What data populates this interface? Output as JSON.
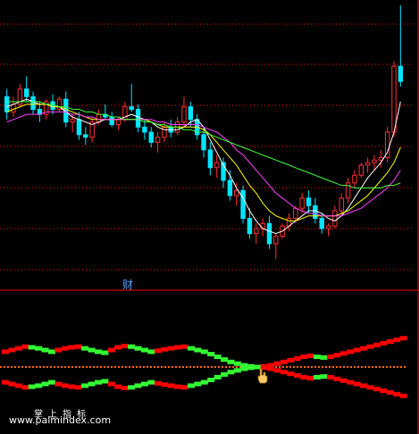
{
  "labels": {
    "cai": "财",
    "watermark_top": "掌上指标",
    "watermark_bottom": "www.palmindex.com"
  },
  "colors": {
    "background": "#000000",
    "up": "#ff3030",
    "down": "#00e5ff",
    "ma_white": "#ffffff",
    "ma_yellow": "#ffff00",
    "ma_magenta": "#ff40ff",
    "ma_green": "#40ff40",
    "grid": "#ff0000",
    "osc_red": "#ff0000",
    "osc_green": "#33ff33",
    "osc_mid": "#ff6600",
    "label_blue": "#5aa0ff"
  },
  "icons": [
    "hand-cursor-icon"
  ],
  "chart_data": [
    {
      "type": "candlestick",
      "title": "",
      "ylim": [
        0,
        100
      ],
      "grid": true,
      "candles": [
        [
          64,
          67,
          55,
          58
        ],
        [
          58,
          64,
          56,
          61
        ],
        [
          61,
          69,
          60,
          67
        ],
        [
          67,
          72,
          62,
          64
        ],
        [
          64,
          66,
          57,
          59
        ],
        [
          59,
          62,
          54,
          57
        ],
        [
          57,
          63,
          55,
          62
        ],
        [
          62,
          65,
          57,
          59
        ],
        [
          59,
          64,
          58,
          63
        ],
        [
          63,
          66,
          52,
          54
        ],
        [
          54,
          57,
          50,
          55
        ],
        [
          55,
          58,
          47,
          49
        ],
        [
          49,
          52,
          45,
          48
        ],
        [
          48,
          56,
          46,
          54
        ],
        [
          54,
          59,
          53,
          57
        ],
        [
          57,
          61,
          55,
          56
        ],
        [
          56,
          58,
          52,
          53
        ],
        [
          53,
          56,
          51,
          55
        ],
        [
          55,
          62,
          54,
          60
        ],
        [
          60,
          69,
          58,
          59
        ],
        [
          59,
          61,
          50,
          52
        ],
        [
          52,
          55,
          47,
          50
        ],
        [
          50,
          52,
          44,
          46
        ],
        [
          46,
          50,
          42,
          48
        ],
        [
          48,
          54,
          46,
          52
        ],
        [
          52,
          55,
          48,
          50
        ],
        [
          50,
          56,
          49,
          54
        ],
        [
          54,
          64,
          52,
          60
        ],
        [
          60,
          62,
          52,
          55
        ],
        [
          55,
          57,
          47,
          49
        ],
        [
          49,
          52,
          40,
          43
        ],
        [
          43,
          46,
          33,
          36
        ],
        [
          36,
          41,
          32,
          38
        ],
        [
          38,
          40,
          28,
          31
        ],
        [
          31,
          35,
          23,
          25
        ],
        [
          25,
          30,
          21,
          27
        ],
        [
          27,
          29,
          14,
          16
        ],
        [
          16,
          20,
          8,
          10
        ],
        [
          10,
          14,
          6,
          12
        ],
        [
          12,
          16,
          9,
          14
        ],
        [
          14,
          17,
          4,
          6
        ],
        [
          6,
          10,
          0,
          9
        ],
        [
          9,
          14,
          8,
          13
        ],
        [
          13,
          18,
          11,
          16
        ],
        [
          16,
          21,
          14,
          20
        ],
        [
          20,
          26,
          18,
          24
        ],
        [
          24,
          27,
          18,
          21
        ],
        [
          21,
          24,
          14,
          16
        ],
        [
          16,
          18,
          10,
          12
        ],
        [
          12,
          14,
          9,
          13
        ],
        [
          13,
          21,
          12,
          19
        ],
        [
          19,
          26,
          17,
          24
        ],
        [
          24,
          32,
          22,
          30
        ],
        [
          30,
          35,
          28,
          33
        ],
        [
          33,
          38,
          32,
          37
        ],
        [
          37,
          40,
          34,
          38
        ],
        [
          38,
          41,
          35,
          39
        ],
        [
          39,
          43,
          36,
          40
        ],
        [
          40,
          52,
          38,
          50
        ],
        [
          50,
          78,
          48,
          76
        ],
        [
          76,
          100,
          68,
          70
        ]
      ],
      "series": [
        {
          "name": "",
          "color": "#ffffff",
          "values": [
            60,
            61,
            62,
            63,
            62,
            61,
            61,
            60,
            60,
            58,
            56,
            55,
            54,
            53,
            54,
            55,
            55,
            55,
            56,
            57,
            56,
            55,
            54,
            52,
            51,
            51,
            51,
            52,
            54,
            55,
            52,
            47,
            42,
            37,
            33,
            28,
            24,
            19,
            15,
            12,
            11,
            10,
            11,
            13,
            15,
            17,
            19,
            19,
            18,
            16,
            15,
            17,
            20,
            24,
            28,
            32,
            35,
            38,
            42,
            50,
            62
          ]
        },
        {
          "name": "",
          "color": "#ffff00",
          "values": [
            58,
            59,
            60,
            61,
            61,
            61,
            61,
            60,
            60,
            59,
            58,
            57,
            56,
            55,
            55,
            55,
            55,
            55,
            55,
            55,
            55,
            55,
            54,
            53,
            52,
            52,
            52,
            52,
            52,
            52,
            51,
            49,
            46,
            43,
            40,
            37,
            33,
            29,
            26,
            22,
            19,
            17,
            16,
            15,
            15,
            16,
            17,
            17,
            17,
            17,
            17,
            18,
            19,
            21,
            23,
            25,
            28,
            31,
            34,
            38,
            44
          ]
        },
        {
          "name": "",
          "color": "#ff40ff",
          "values": [
            54,
            55,
            56,
            57,
            57,
            57,
            58,
            58,
            58,
            58,
            57,
            57,
            56,
            56,
            55,
            55,
            55,
            55,
            55,
            55,
            55,
            55,
            55,
            54,
            54,
            53,
            53,
            53,
            53,
            53,
            52,
            51,
            50,
            48,
            46,
            43,
            41,
            38,
            35,
            32,
            29,
            26,
            24,
            22,
            20,
            19,
            18,
            18,
            17,
            17,
            17,
            17,
            18,
            19,
            20,
            22,
            24,
            26,
            28,
            31,
            35
          ]
        },
        {
          "name": "",
          "color": "#40ff40",
          "values": [
            62,
            62,
            62,
            62,
            62,
            62,
            61,
            61,
            60,
            60,
            59,
            59,
            58,
            58,
            57,
            57,
            56,
            56,
            55,
            55,
            55,
            54,
            54,
            53,
            53,
            52,
            52,
            51,
            51,
            50,
            50,
            49,
            48,
            47,
            46,
            45,
            44,
            43,
            42,
            41,
            40,
            39,
            38,
            37,
            36,
            35,
            34,
            33,
            32,
            31,
            30,
            29,
            29,
            28,
            28,
            28,
            28,
            28,
            29,
            29,
            30
          ]
        }
      ]
    },
    {
      "type": "area",
      "title": "",
      "ylim": [
        -1,
        1
      ],
      "series": [
        {
          "name": "",
          "color": "#ff0000",
          "values": [
            0.45,
            0.5,
            0.55,
            0.6,
            0.58,
            0.55,
            0.5,
            0.45,
            0.5,
            0.55,
            0.58,
            0.6,
            0.55,
            0.5,
            0.45,
            0.42,
            0.5,
            0.58,
            0.62,
            0.6,
            0.55,
            0.5,
            0.45,
            0.48,
            0.52,
            0.55,
            0.58,
            0.6,
            0.55,
            0.5,
            0.45,
            0.38,
            0.3,
            0.22,
            0.15,
            0.1,
            0.05,
            0.02,
            0.0,
            0.02,
            0.05,
            0.1,
            0.15,
            0.2,
            0.25,
            0.3,
            0.33,
            0.3,
            0.28,
            0.3,
            0.35,
            0.4,
            0.45,
            0.5,
            0.55,
            0.6,
            0.65,
            0.7,
            0.75,
            0.8,
            0.85
          ]
        },
        {
          "name": "",
          "color": "#33ff33",
          "values": [
            -0.45,
            -0.5,
            -0.55,
            -0.6,
            -0.58,
            -0.55,
            -0.5,
            -0.45,
            -0.5,
            -0.55,
            -0.58,
            -0.6,
            -0.55,
            -0.5,
            -0.45,
            -0.42,
            -0.5,
            -0.58,
            -0.62,
            -0.6,
            -0.55,
            -0.5,
            -0.45,
            -0.48,
            -0.52,
            -0.55,
            -0.58,
            -0.6,
            -0.55,
            -0.5,
            -0.45,
            -0.38,
            -0.3,
            -0.22,
            -0.15,
            -0.1,
            -0.05,
            -0.02,
            0.0,
            -0.02,
            -0.05,
            -0.1,
            -0.15,
            -0.2,
            -0.25,
            -0.3,
            -0.33,
            -0.3,
            -0.28,
            -0.3,
            -0.35,
            -0.4,
            -0.45,
            -0.5,
            -0.55,
            -0.6,
            -0.65,
            -0.7,
            -0.75,
            -0.8,
            -0.85
          ]
        }
      ]
    }
  ]
}
